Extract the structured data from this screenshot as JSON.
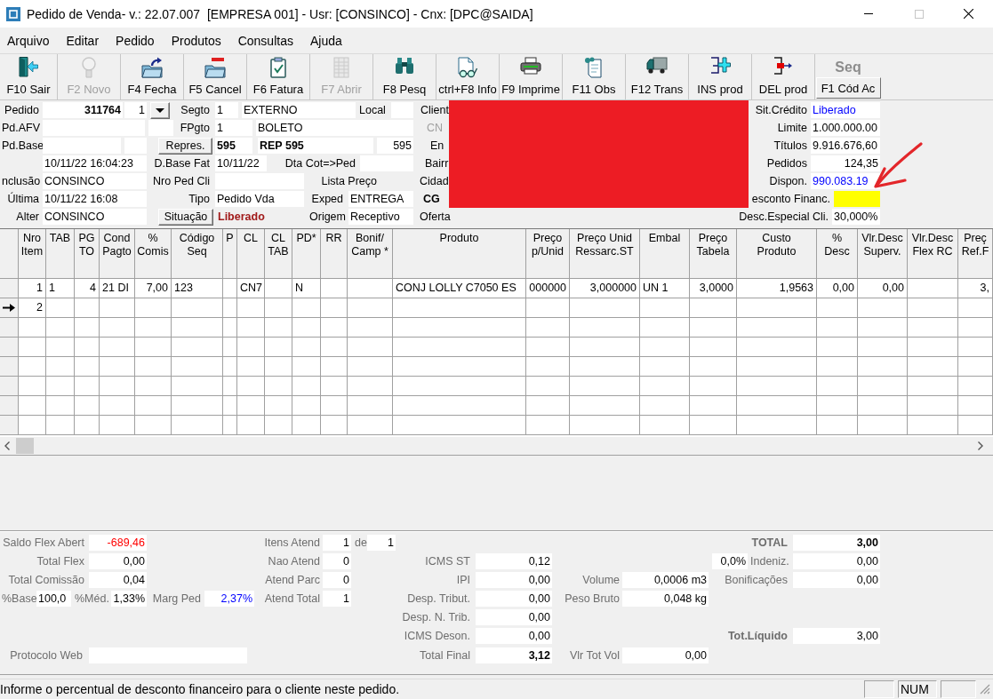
{
  "window": {
    "title": "Pedido de Venda- v.: 22.07.007  [EMPRESA 001] - Usr: [CONSINCO] - Cnx: [DPC@SAIDA]",
    "maximize_disabled": true
  },
  "menu": [
    "Arquivo",
    "Editar",
    "Pedido",
    "Produtos",
    "Consultas",
    "Ajuda"
  ],
  "toolbar": [
    {
      "kind": "icon",
      "label": "F10 Sair",
      "disabled": false
    },
    {
      "kind": "icon",
      "label": "F2 Novo",
      "disabled": true
    },
    {
      "kind": "icon",
      "label": "F4 Fecha",
      "disabled": false
    },
    {
      "kind": "icon",
      "label": "F5 Cancel",
      "disabled": false
    },
    {
      "kind": "icon",
      "label": "F6 Fatura",
      "disabled": false
    },
    {
      "kind": "icon",
      "label": "F7 Abrir",
      "disabled": true
    },
    {
      "kind": "icon",
      "label": "F8 Pesq",
      "disabled": false
    },
    {
      "kind": "icon",
      "label": "ctrl+F8 Info",
      "disabled": false
    },
    {
      "kind": "icon",
      "label": "F9 Imprime",
      "disabled": false
    },
    {
      "kind": "icon",
      "label": "F11 Obs",
      "disabled": false
    },
    {
      "kind": "icon",
      "label": "F12 Trans",
      "disabled": false
    },
    {
      "kind": "icon",
      "label": "INS prod",
      "disabled": false
    },
    {
      "kind": "icon",
      "label": "DEL prod",
      "disabled": false
    },
    {
      "kind": "caption",
      "caption": "Seq",
      "label": "F1 Cód Ac",
      "disabled": false
    }
  ],
  "header_form": {
    "items": [
      {
        "kind": "label",
        "text": "Pedido",
        "disabled": false
      },
      {
        "kind": "field",
        "value": "311764",
        "focused": false
      },
      {
        "kind": "field",
        "value": "1",
        "focused": false
      },
      {
        "kind": "dropdown"
      },
      {
        "kind": "label",
        "text": "Segto",
        "disabled": false
      },
      {
        "kind": "field",
        "value": "1",
        "focused": false
      },
      {
        "kind": "field",
        "value": "EXTERNO",
        "focused": false
      },
      {
        "kind": "label",
        "text": "Local",
        "disabled": false
      },
      {
        "kind": "field",
        "focused": false
      },
      {
        "kind": "label",
        "text": "Client",
        "disabled": false
      },
      {
        "kind": "label",
        "text": "Sit.Crédito",
        "disabled": false
      },
      {
        "kind": "field",
        "value": "Liberado",
        "color": "#0000ff",
        "focused": false
      },
      {
        "kind": "label",
        "text": "Pd.AFV",
        "disabled": false
      },
      {
        "kind": "field",
        "focused": false
      },
      {
        "kind": "field",
        "focused": false
      },
      {
        "kind": "label",
        "text": "FPgto",
        "disabled": false
      },
      {
        "kind": "field",
        "value": "1",
        "focused": false
      },
      {
        "kind": "field",
        "value": "BOLETO",
        "focused": false
      },
      {
        "kind": "label",
        "text": "CN",
        "disabled": true
      },
      {
        "kind": "label",
        "text": "Limite",
        "disabled": false
      },
      {
        "kind": "field",
        "value": "1.000.000.00",
        "focused": false
      },
      {
        "kind": "label",
        "text": "Pd.Base",
        "disabled": false
      },
      {
        "kind": "field",
        "focused": false
      },
      {
        "kind": "field",
        "focused": false
      },
      {
        "kind": "button",
        "text": "Repres."
      },
      {
        "kind": "field",
        "value": "595",
        "focused": false
      },
      {
        "kind": "field",
        "value": "REP 595",
        "focused": false
      },
      {
        "kind": "field",
        "value": "595",
        "focused": false
      },
      {
        "kind": "label",
        "text": "En",
        "disabled": false
      },
      {
        "kind": "label",
        "text": "Títulos",
        "disabled": false
      },
      {
        "kind": "field",
        "value": "9.916.676,60",
        "focused": false
      },
      {
        "kind": "field",
        "value": "10/11/22 16:04:23",
        "focused": false
      },
      {
        "kind": "label",
        "text": "D.Base Fat",
        "disabled": false
      },
      {
        "kind": "field",
        "value": "10/11/22",
        "focused": false
      },
      {
        "kind": "label",
        "text": "Dta Cot=>Ped",
        "disabled": false
      },
      {
        "kind": "field",
        "focused": false
      },
      {
        "kind": "label",
        "text": "Bairr",
        "disabled": false
      },
      {
        "kind": "label",
        "text": "Pedidos",
        "disabled": false
      },
      {
        "kind": "field",
        "value": "124,35",
        "focused": false
      },
      {
        "kind": "label",
        "text": "nclusão",
        "disabled": false
      },
      {
        "kind": "field",
        "value": "CONSINCO",
        "focused": false
      },
      {
        "kind": "label",
        "text": "Nro Ped Cli",
        "disabled": false
      },
      {
        "kind": "field",
        "focused": false
      },
      {
        "kind": "label",
        "text": "Lista Preço",
        "disabled": false
      },
      {
        "kind": "label",
        "text": "Cidad",
        "disabled": false
      },
      {
        "kind": "label",
        "text": "Dispon.",
        "disabled": false
      },
      {
        "kind": "field",
        "value": "990.083.19",
        "color": "#0000ff",
        "focused": false
      },
      {
        "kind": "label",
        "text": "Última",
        "disabled": false
      },
      {
        "kind": "field",
        "value": "10/11/22 16:08",
        "focused": false
      },
      {
        "kind": "label",
        "text": "Tipo",
        "disabled": false
      },
      {
        "kind": "field",
        "value": "Pedido Vda",
        "focused": false
      },
      {
        "kind": "label",
        "text": "Exped",
        "disabled": false
      },
      {
        "kind": "field",
        "value": "ENTREGA",
        "focused": false
      },
      {
        "kind": "label",
        "text": "CG",
        "disabled": false
      },
      {
        "kind": "label",
        "text": "esconto Financ.",
        "disabled": false
      },
      {
        "kind": "field",
        "focused": true
      },
      {
        "kind": "label",
        "text": "Alter",
        "disabled": false
      },
      {
        "kind": "field",
        "value": "CONSINCO",
        "focused": false
      },
      {
        "kind": "button",
        "text": "Situação"
      },
      {
        "kind": "value",
        "text": "Liberado",
        "color": "#a11b1b"
      },
      {
        "kind": "label",
        "text": "Origem",
        "disabled": false
      },
      {
        "kind": "field",
        "value": "Receptivo",
        "focused": false
      },
      {
        "kind": "label",
        "text": "Oferta",
        "disabled": false
      },
      {
        "kind": "label",
        "text": "Desc.Especial Cli.",
        "disabled": false
      },
      {
        "kind": "field",
        "value": "30,000%",
        "focused": false
      }
    ]
  },
  "items_table": {
    "columns": [
      "Nro\nItem",
      "TAB",
      "PG\nTO",
      "Cond\nPagto",
      "%\nComis",
      "Código\nSeq",
      "P",
      "CL",
      "CL\nTAB",
      "PD*",
      "RR",
      "Bonif/\nCamp *",
      "Produto",
      "Preço\np/Unid",
      "Preço Unid\nRessarc.ST",
      "Embal",
      "Preço\nTabela",
      "Custo\nProduto",
      "%\nDesc",
      "Vlr.Desc\nSuperv.",
      "Vlr.Desc\nFlex RC",
      "Preç\nRef.F"
    ],
    "rows": [
      {
        "current": false,
        "cells": [
          "1",
          "1",
          "4",
          "21 DI",
          "7,00",
          "123",
          null,
          "CN7",
          null,
          "N",
          null,
          null,
          "CONJ LOLLY C7050 ES",
          "000000",
          "3,000000",
          "UN 1",
          "3,0000",
          "1,9563",
          "0,00",
          "0,00",
          null,
          "3,"
        ]
      },
      {
        "current": true,
        "cells": [
          "2"
        ]
      }
    ]
  },
  "totals_panel": {
    "items": [
      {
        "kind": "label",
        "text": "Saldo Flex Abert"
      },
      {
        "kind": "field",
        "value": "-689,46",
        "color": "#ff0000"
      },
      {
        "kind": "label",
        "text": "Itens Atend"
      },
      {
        "kind": "field",
        "value": "1"
      },
      {
        "kind": "label",
        "text": "de"
      },
      {
        "kind": "field",
        "value": "1"
      },
      {
        "kind": "label",
        "text": "TOTAL"
      },
      {
        "kind": "field",
        "value": "3,00"
      },
      {
        "kind": "label",
        "text": "Total Flex"
      },
      {
        "kind": "field",
        "value": "0,00"
      },
      {
        "kind": "label",
        "text": "Nao Atend"
      },
      {
        "kind": "field",
        "value": "0"
      },
      {
        "kind": "label",
        "text": "ICMS ST"
      },
      {
        "kind": "field",
        "value": "0,12"
      },
      {
        "kind": "field",
        "value": "0,0%"
      },
      {
        "kind": "label",
        "text": "Indeniz."
      },
      {
        "kind": "field",
        "value": "0,00"
      },
      {
        "kind": "label",
        "text": "Total Comissão"
      },
      {
        "kind": "field",
        "value": "0,04"
      },
      {
        "kind": "label",
        "text": "Atend Parc"
      },
      {
        "kind": "field",
        "value": "0"
      },
      {
        "kind": "label",
        "text": "IPI"
      },
      {
        "kind": "field",
        "value": "0,00"
      },
      {
        "kind": "label",
        "text": "Volume"
      },
      {
        "kind": "field",
        "value": "0,0006 m3"
      },
      {
        "kind": "label",
        "text": "Bonificações"
      },
      {
        "kind": "field",
        "value": "0,00"
      },
      {
        "kind": "label",
        "text": "%Base"
      },
      {
        "kind": "field",
        "value": "100,0"
      },
      {
        "kind": "label",
        "text": "%Méd."
      },
      {
        "kind": "field",
        "value": "1,33%"
      },
      {
        "kind": "label",
        "text": "Marg Ped"
      },
      {
        "kind": "field",
        "value": "2,37%",
        "color": "#0000ff"
      },
      {
        "kind": "label",
        "text": "Atend Total"
      },
      {
        "kind": "field",
        "value": "1"
      },
      {
        "kind": "label",
        "text": "Desp. Tribut."
      },
      {
        "kind": "field",
        "value": "0,00"
      },
      {
        "kind": "label",
        "text": "Peso Bruto"
      },
      {
        "kind": "field",
        "value": "0,048 kg"
      },
      {
        "kind": "label",
        "text": "Desp. N. Trib."
      },
      {
        "kind": "field",
        "value": "0,00"
      },
      {
        "kind": "label",
        "text": "ICMS Deson."
      },
      {
        "kind": "field",
        "value": "0,00"
      },
      {
        "kind": "label",
        "text": "Tot.Líquido"
      },
      {
        "kind": "field",
        "value": "3,00"
      },
      {
        "kind": "label",
        "text": "Protocolo Web"
      },
      {
        "kind": "field"
      },
      {
        "kind": "label",
        "text": "Total Final"
      },
      {
        "kind": "field",
        "value": "3,12"
      },
      {
        "kind": "label",
        "text": "Vlr Tot Vol"
      },
      {
        "kind": "field",
        "value": "0,00"
      }
    ]
  },
  "status_bar": {
    "message": "Informe o percentual de desconto financeiro para o cliente neste pedido.",
    "num_indicator": "NUM"
  }
}
